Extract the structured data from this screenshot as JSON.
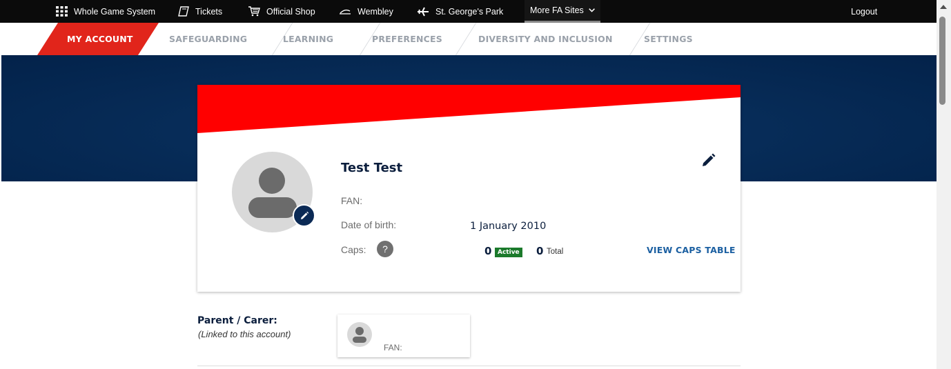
{
  "topbar": {
    "items": [
      {
        "label": "Whole Game System",
        "icon": "grid-icon"
      },
      {
        "label": "Tickets",
        "icon": "ticket-icon"
      },
      {
        "label": "Official Shop",
        "icon": "cart-icon"
      },
      {
        "label": "Wembley",
        "icon": "wembley-icon"
      },
      {
        "label": "St. George's Park",
        "icon": "plane-icon"
      }
    ],
    "more_label": "More FA Sites",
    "logout_label": "Logout"
  },
  "tabs": [
    "MY ACCOUNT",
    "SAFEGUARDING",
    "LEARNING",
    "PREFERENCES",
    "DIVERSITY AND INCLUSION",
    "SETTINGS"
  ],
  "active_tab": 0,
  "colors": {
    "accent_red": "#e1251b",
    "hero_navy": "#062a55",
    "active_badge": "#1b7a2b",
    "link_blue": "#1b5fa1"
  },
  "profile": {
    "name": "Test Test",
    "fan_label": "FAN:",
    "fan_value": "",
    "dob_label": "Date of birth:",
    "dob_value": "1 January 2010",
    "caps_label": "Caps:",
    "caps_help": "?",
    "caps_active_count": "0",
    "caps_active_label": "Active",
    "caps_total_count": "0",
    "caps_total_label": "Total",
    "view_caps_label": "VIEW CAPS TABLE"
  },
  "parent": {
    "title": "Parent / Carer:",
    "subtitle": "(Linked to this account)",
    "fan_label": "FAN:"
  }
}
